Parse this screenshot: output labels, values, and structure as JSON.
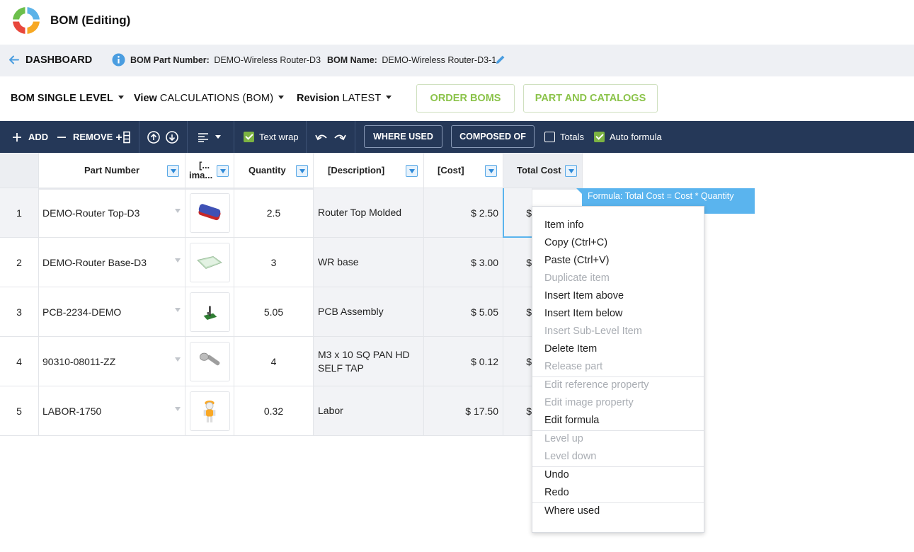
{
  "app": {
    "title": "BOM (Editing)"
  },
  "infobar": {
    "back_label": "DASHBOARD",
    "part_number_label": "BOM Part Number:",
    "part_number_value": "DEMO-Wireless Router-D3",
    "bom_name_label": "BOM Name:",
    "bom_name_value": "DEMO-Wireless Router-D3-1"
  },
  "selectors": [
    {
      "label": "BOM",
      "value": "SINGLE LEVEL"
    },
    {
      "label": "View",
      "value": "CALCULATIONS (BOM)"
    },
    {
      "label": "Revision",
      "value": "LATEST"
    }
  ],
  "actions": {
    "order_boms": "ORDER BOMS",
    "part_and_catalogs": "PART AND CATALOGS"
  },
  "toolbar": {
    "add": "ADD",
    "remove": "REMOVE",
    "text_wrap": "Text wrap",
    "text_wrap_checked": true,
    "where_used": "WHERE USED",
    "composed_of": "COMPOSED OF",
    "totals": "Totals",
    "totals_checked": false,
    "auto_formula": "Auto formula",
    "auto_formula_checked": true
  },
  "table": {
    "columns": [
      "Part Number",
      "[...\nima...",
      "Quantity",
      "[Description]",
      "[Cost]",
      "Total Cost"
    ],
    "column_image_line1": "[...",
    "column_image_line2": "ima...",
    "rows": [
      {
        "num": "1",
        "part": "DEMO-Router Top-D3",
        "image": "router-top-icon",
        "qty": "2.5",
        "desc": "Router Top Molded",
        "cost": "$ 2.50",
        "total": "$"
      },
      {
        "num": "2",
        "part": "DEMO-Router Base-D3",
        "image": "router-base-icon",
        "qty": "3",
        "desc": "WR base",
        "cost": "$ 3.00",
        "total": "$"
      },
      {
        "num": "3",
        "part": "PCB-2234-DEMO",
        "image": "pcb-icon",
        "qty": "5.05",
        "desc": "PCB Assembly",
        "cost": "$ 5.05",
        "total": "$"
      },
      {
        "num": "4",
        "part": "90310-08011-ZZ",
        "image": "screw-icon",
        "qty": "4",
        "desc": "M3 x 10 SQ PAN HD SELF TAP",
        "cost": "$ 0.12",
        "total": "$"
      },
      {
        "num": "5",
        "part": "LABOR-1750",
        "image": "worker-icon",
        "qty": "0.32",
        "desc": "Labor",
        "cost": "$ 17.50",
        "total": "$"
      }
    ]
  },
  "tooltip": {
    "text": "Formula: Total Cost = Cost * Quantity"
  },
  "context_menu": {
    "items": [
      {
        "label": "Item info",
        "disabled": false
      },
      {
        "label": "Copy (Ctrl+C)",
        "disabled": false
      },
      {
        "label": "Paste (Ctrl+V)",
        "disabled": false
      },
      {
        "label": "Duplicate item",
        "disabled": true
      },
      {
        "label": "Insert Item above",
        "disabled": false
      },
      {
        "label": "Insert Item below",
        "disabled": false
      },
      {
        "label": "Insert Sub-Level Item",
        "disabled": true
      },
      {
        "label": "Delete Item",
        "disabled": false
      },
      {
        "label": "Release part",
        "disabled": true
      },
      {
        "label": "Edit reference property",
        "disabled": true
      },
      {
        "label": "Edit image property",
        "disabled": true
      },
      {
        "label": "Edit formula",
        "disabled": false
      },
      {
        "label": "Level up",
        "disabled": true
      },
      {
        "label": "Level down",
        "disabled": true
      },
      {
        "label": "Undo",
        "disabled": false
      },
      {
        "label": "Redo",
        "disabled": false
      },
      {
        "label": "Where used",
        "disabled": false
      }
    ]
  },
  "colors": {
    "toolbar_bg": "#253858",
    "accent_green": "#8bc34a",
    "accent_blue": "#5ab4ee",
    "info_bg": "#eef0f4"
  }
}
